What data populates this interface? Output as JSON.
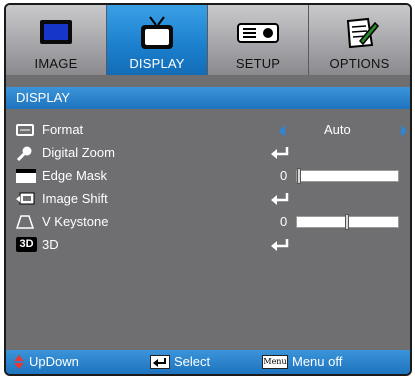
{
  "tabs": [
    {
      "label": "IMAGE",
      "icon": "monitor-icon",
      "active": false
    },
    {
      "label": "DISPLAY",
      "icon": "tv-icon",
      "active": true
    },
    {
      "label": "SETUP",
      "icon": "projector-icon",
      "active": false
    },
    {
      "label": "OPTIONS",
      "icon": "notepad-pen-icon",
      "active": false
    }
  ],
  "section": {
    "title": "DISPLAY"
  },
  "rows": [
    {
      "label": "Format",
      "value": "Auto",
      "icon": "format-icon"
    },
    {
      "label": "Digital Zoom",
      "icon": "magnifier-icon"
    },
    {
      "label": "Edge Mask",
      "value": "0",
      "slider_level": 0.0,
      "icon": "edge-mask-icon"
    },
    {
      "label": "Image Shift",
      "icon": "image-shift-icon"
    },
    {
      "label": "V Keystone",
      "value": "0",
      "slider_level": 0.5,
      "icon": "keystone-icon"
    },
    {
      "label": "3D",
      "icon": "3d-icon",
      "icon_text": "3D"
    }
  ],
  "footer": {
    "updown": "UpDown",
    "select": "Select",
    "menu_key": "Menu",
    "menu_off": "Menu off"
  },
  "colors": {
    "accent": "#1e74bf",
    "panel": "#6f6f72",
    "arrow": "#2c86d6",
    "updown": "#e53935"
  }
}
